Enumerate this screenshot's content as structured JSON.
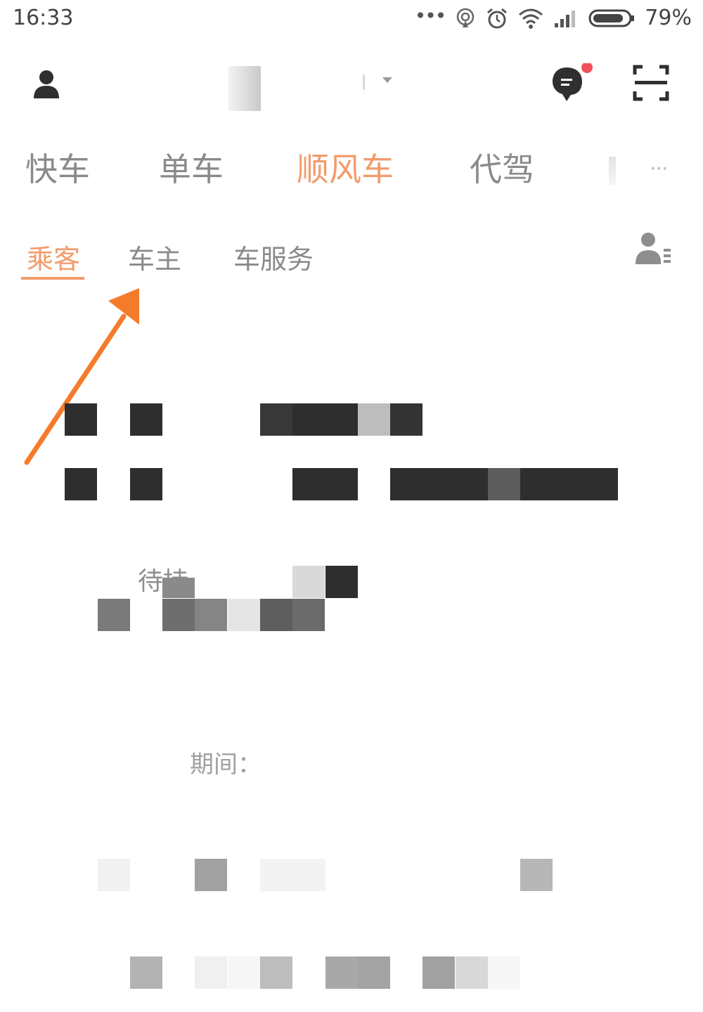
{
  "status_bar": {
    "time": "16:33",
    "dots": "•••",
    "battery": "79%",
    "icons": [
      "hotspot-icon",
      "alarm-icon",
      "wifi-icon",
      "signal-icon",
      "battery-icon"
    ]
  },
  "header": {
    "icons": [
      "user-icon",
      "message-icon",
      "scan-icon"
    ],
    "badge_color": "#f0505a"
  },
  "service_tabs": {
    "items": [
      {
        "label": "快车",
        "active": false
      },
      {
        "label": "单车",
        "active": false
      },
      {
        "label": "顺风车",
        "active": true
      },
      {
        "label": "代驾",
        "active": false
      }
    ],
    "more": "···"
  },
  "sub_tabs": {
    "items": [
      {
        "label": "乘客",
        "active": true
      },
      {
        "label": "车主",
        "active": false
      },
      {
        "label": "车服务",
        "active": false
      }
    ]
  },
  "content": {
    "faded_fragments": [
      "待持",
      "期间："
    ]
  },
  "colors": {
    "accent": "#f29b6c",
    "arrow": "#f47b2a",
    "inactive_text": "#8a8a8a",
    "icon_dark": "#2f2f2f"
  }
}
